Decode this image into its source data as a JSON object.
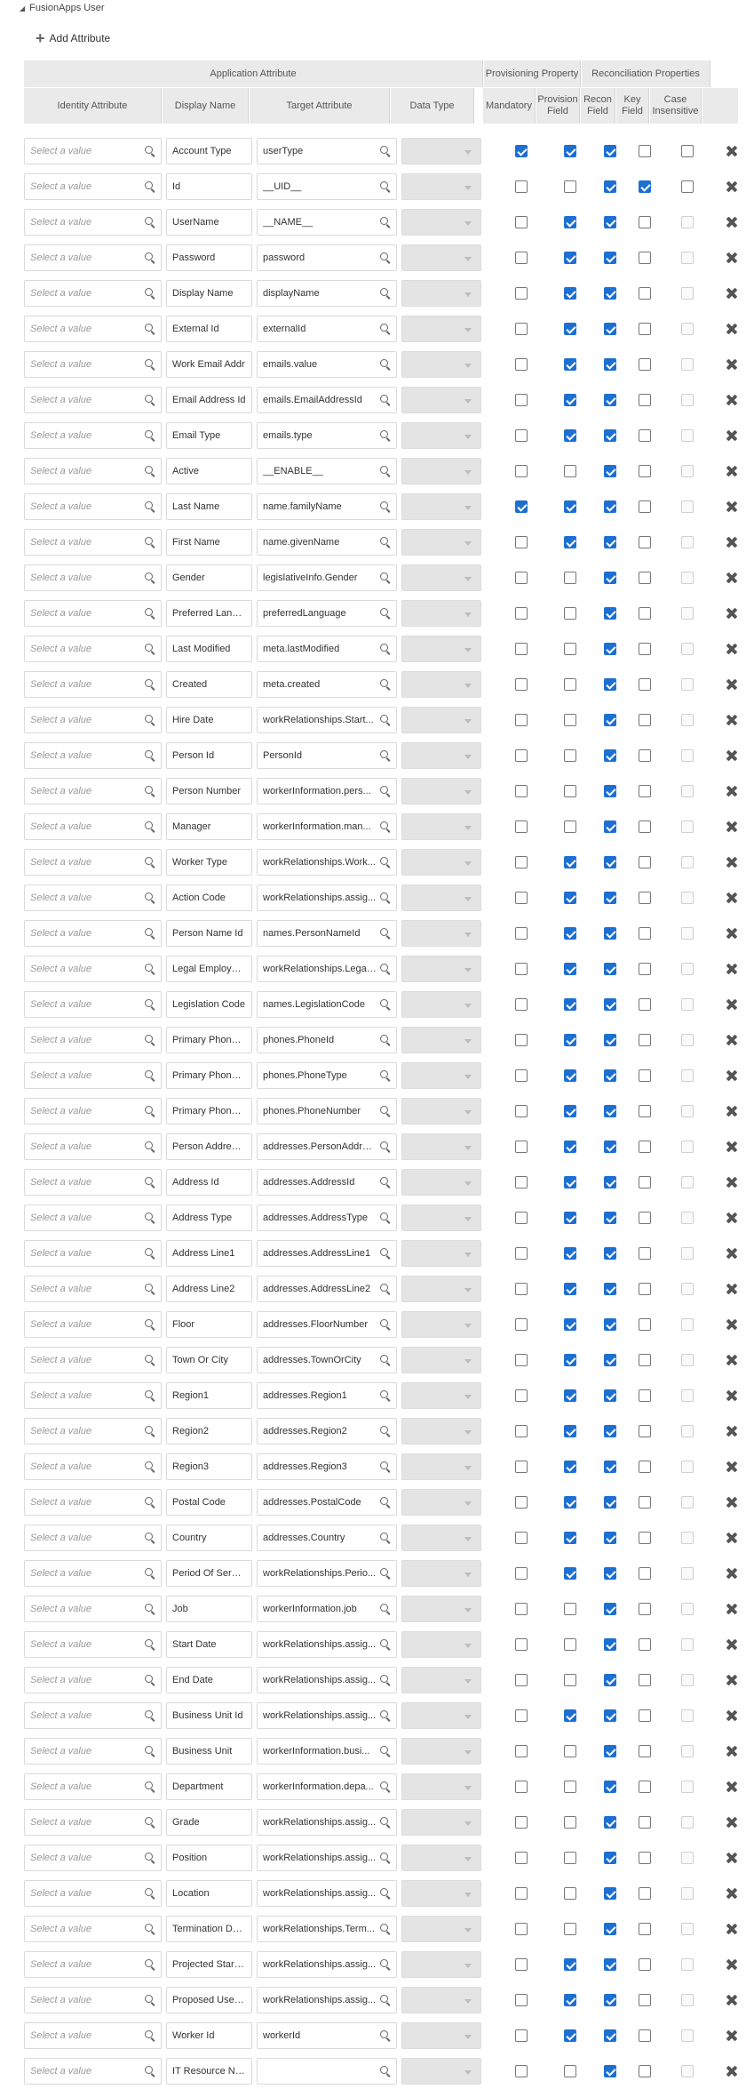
{
  "section": {
    "title": "FusionApps User"
  },
  "toolbar": {
    "add_label": "Add Attribute"
  },
  "headers": {
    "group_application": "Application Attribute",
    "group_provisioning": "Provisioning Property",
    "group_reconciliation": "Reconciliation Properties",
    "identity_attribute": "Identity Attribute",
    "display_name": "Display Name",
    "target_attribute": "Target Attribute",
    "data_type": "Data Type",
    "mandatory": "Mandatory",
    "provision_field": "Provision Field",
    "recon_field": "Recon Field",
    "key_field": "Key Field",
    "case_insensitive": "Case Insensitive"
  },
  "placeholder": "Select a value",
  "rows": [
    {
      "display": "Account Type",
      "target": "userType",
      "mandatory": true,
      "provision": true,
      "recon": true,
      "key": false,
      "case": false,
      "case_enabled": true
    },
    {
      "display": "Id",
      "target": "__UID__",
      "mandatory": false,
      "provision": false,
      "recon": true,
      "key": true,
      "case": false,
      "case_enabled": true
    },
    {
      "display": "UserName",
      "target": "__NAME__",
      "mandatory": false,
      "provision": true,
      "recon": true,
      "key": false,
      "case": false,
      "case_enabled": false
    },
    {
      "display": "Password",
      "target": "password",
      "mandatory": false,
      "provision": true,
      "recon": true,
      "key": false,
      "case": false,
      "case_enabled": false
    },
    {
      "display": "Display Name",
      "target": "displayName",
      "mandatory": false,
      "provision": true,
      "recon": true,
      "key": false,
      "case": false,
      "case_enabled": false
    },
    {
      "display": "External Id",
      "target": "externalId",
      "mandatory": false,
      "provision": true,
      "recon": true,
      "key": false,
      "case": false,
      "case_enabled": false
    },
    {
      "display": "Work Email Addr",
      "target": "emails.value",
      "mandatory": false,
      "provision": true,
      "recon": true,
      "key": false,
      "case": false,
      "case_enabled": false
    },
    {
      "display": "Email Address Id",
      "target": "emails.EmailAddressId",
      "mandatory": false,
      "provision": true,
      "recon": true,
      "key": false,
      "case": false,
      "case_enabled": false
    },
    {
      "display": "Email Type",
      "target": "emails.type",
      "mandatory": false,
      "provision": true,
      "recon": true,
      "key": false,
      "case": false,
      "case_enabled": false
    },
    {
      "display": "Active",
      "target": "__ENABLE__",
      "mandatory": false,
      "provision": false,
      "recon": true,
      "key": false,
      "case": false,
      "case_enabled": false
    },
    {
      "display": "Last Name",
      "target": "name.familyName",
      "mandatory": true,
      "provision": true,
      "recon": true,
      "key": false,
      "case": false,
      "case_enabled": false
    },
    {
      "display": "First Name",
      "target": "name.givenName",
      "mandatory": false,
      "provision": true,
      "recon": true,
      "key": false,
      "case": false,
      "case_enabled": false
    },
    {
      "display": "Gender",
      "target": "legislativeInfo.Gender",
      "mandatory": false,
      "provision": false,
      "recon": true,
      "key": false,
      "case": false,
      "case_enabled": false
    },
    {
      "display": "Preferred Langua",
      "target": "preferredLanguage",
      "mandatory": false,
      "provision": false,
      "recon": true,
      "key": false,
      "case": false,
      "case_enabled": false
    },
    {
      "display": "Last Modified",
      "target": "meta.lastModified",
      "mandatory": false,
      "provision": false,
      "recon": true,
      "key": false,
      "case": false,
      "case_enabled": false
    },
    {
      "display": "Created",
      "target": "meta.created",
      "mandatory": false,
      "provision": false,
      "recon": true,
      "key": false,
      "case": false,
      "case_enabled": false
    },
    {
      "display": "Hire Date",
      "target": "workRelationships.Start...",
      "mandatory": false,
      "provision": false,
      "recon": true,
      "key": false,
      "case": false,
      "case_enabled": false
    },
    {
      "display": "Person Id",
      "target": "PersonId",
      "mandatory": false,
      "provision": false,
      "recon": true,
      "key": false,
      "case": false,
      "case_enabled": false
    },
    {
      "display": "Person Number",
      "target": "workerInformation.pers...",
      "mandatory": false,
      "provision": false,
      "recon": true,
      "key": false,
      "case": false,
      "case_enabled": false
    },
    {
      "display": "Manager",
      "target": "workerInformation.man...",
      "mandatory": false,
      "provision": false,
      "recon": true,
      "key": false,
      "case": false,
      "case_enabled": false
    },
    {
      "display": "Worker Type",
      "target": "workRelationships.Work...",
      "mandatory": false,
      "provision": true,
      "recon": true,
      "key": false,
      "case": false,
      "case_enabled": false
    },
    {
      "display": "Action Code",
      "target": "workRelationships.assig...",
      "mandatory": false,
      "provision": true,
      "recon": true,
      "key": false,
      "case": false,
      "case_enabled": false
    },
    {
      "display": "Person Name Id",
      "target": "names.PersonNameId",
      "mandatory": false,
      "provision": true,
      "recon": true,
      "key": false,
      "case": false,
      "case_enabled": false
    },
    {
      "display": "Legal Employer N",
      "target": "workRelationships.Legal...",
      "mandatory": false,
      "provision": true,
      "recon": true,
      "key": false,
      "case": false,
      "case_enabled": false
    },
    {
      "display": "Legislation Code",
      "target": "names.LegislationCode",
      "mandatory": false,
      "provision": true,
      "recon": true,
      "key": false,
      "case": false,
      "case_enabled": false
    },
    {
      "display": "Primary Phone Id",
      "target": "phones.PhoneId",
      "mandatory": false,
      "provision": true,
      "recon": true,
      "key": false,
      "case": false,
      "case_enabled": false
    },
    {
      "display": "Primary Phone Ty",
      "target": "phones.PhoneType",
      "mandatory": false,
      "provision": true,
      "recon": true,
      "key": false,
      "case": false,
      "case_enabled": false
    },
    {
      "display": "Primary Phone N",
      "target": "phones.PhoneNumber",
      "mandatory": false,
      "provision": true,
      "recon": true,
      "key": false,
      "case": false,
      "case_enabled": false
    },
    {
      "display": "Person Address U",
      "target": "addresses.PersonAddrU...",
      "mandatory": false,
      "provision": true,
      "recon": true,
      "key": false,
      "case": false,
      "case_enabled": false
    },
    {
      "display": "Address Id",
      "target": "addresses.AddressId",
      "mandatory": false,
      "provision": true,
      "recon": true,
      "key": false,
      "case": false,
      "case_enabled": false
    },
    {
      "display": "Address Type",
      "target": "addresses.AddressType",
      "mandatory": false,
      "provision": true,
      "recon": true,
      "key": false,
      "case": false,
      "case_enabled": false
    },
    {
      "display": "Address Line1",
      "target": "addresses.AddressLine1",
      "mandatory": false,
      "provision": true,
      "recon": true,
      "key": false,
      "case": false,
      "case_enabled": false
    },
    {
      "display": "Address Line2",
      "target": "addresses.AddressLine2",
      "mandatory": false,
      "provision": true,
      "recon": true,
      "key": false,
      "case": false,
      "case_enabled": false
    },
    {
      "display": "Floor",
      "target": "addresses.FloorNumber",
      "mandatory": false,
      "provision": true,
      "recon": true,
      "key": false,
      "case": false,
      "case_enabled": false
    },
    {
      "display": "Town Or City",
      "target": "addresses.TownOrCity",
      "mandatory": false,
      "provision": true,
      "recon": true,
      "key": false,
      "case": false,
      "case_enabled": false
    },
    {
      "display": "Region1",
      "target": "addresses.Region1",
      "mandatory": false,
      "provision": true,
      "recon": true,
      "key": false,
      "case": false,
      "case_enabled": false
    },
    {
      "display": "Region2",
      "target": "addresses.Region2",
      "mandatory": false,
      "provision": true,
      "recon": true,
      "key": false,
      "case": false,
      "case_enabled": false
    },
    {
      "display": "Region3",
      "target": "addresses.Region3",
      "mandatory": false,
      "provision": true,
      "recon": true,
      "key": false,
      "case": false,
      "case_enabled": false
    },
    {
      "display": "Postal Code",
      "target": "addresses.PostalCode",
      "mandatory": false,
      "provision": true,
      "recon": true,
      "key": false,
      "case": false,
      "case_enabled": false
    },
    {
      "display": "Country",
      "target": "addresses.Country",
      "mandatory": false,
      "provision": true,
      "recon": true,
      "key": false,
      "case": false,
      "case_enabled": false
    },
    {
      "display": "Period Of Service",
      "target": "workRelationships.Perio...",
      "mandatory": false,
      "provision": true,
      "recon": true,
      "key": false,
      "case": false,
      "case_enabled": false
    },
    {
      "display": "Job",
      "target": "workerInformation.job",
      "mandatory": false,
      "provision": false,
      "recon": true,
      "key": false,
      "case": false,
      "case_enabled": false
    },
    {
      "display": "Start Date",
      "target": "workRelationships.assig...",
      "mandatory": false,
      "provision": false,
      "recon": true,
      "key": false,
      "case": false,
      "case_enabled": false
    },
    {
      "display": "End Date",
      "target": "workRelationships.assig...",
      "mandatory": false,
      "provision": false,
      "recon": true,
      "key": false,
      "case": false,
      "case_enabled": false
    },
    {
      "display": "Business Unit Id",
      "target": "workRelationships.assig...",
      "mandatory": false,
      "provision": true,
      "recon": true,
      "key": false,
      "case": false,
      "case_enabled": false
    },
    {
      "display": "Business Unit",
      "target": "workerInformation.busi...",
      "mandatory": false,
      "provision": false,
      "recon": true,
      "key": false,
      "case": false,
      "case_enabled": false
    },
    {
      "display": "Department",
      "target": "workerInformation.depa...",
      "mandatory": false,
      "provision": false,
      "recon": true,
      "key": false,
      "case": false,
      "case_enabled": false
    },
    {
      "display": "Grade",
      "target": "workRelationships.assig...",
      "mandatory": false,
      "provision": false,
      "recon": true,
      "key": false,
      "case": false,
      "case_enabled": false
    },
    {
      "display": "Position",
      "target": "workRelationships.assig...",
      "mandatory": false,
      "provision": false,
      "recon": true,
      "key": false,
      "case": false,
      "case_enabled": false
    },
    {
      "display": "Location",
      "target": "workRelationships.assig...",
      "mandatory": false,
      "provision": false,
      "recon": true,
      "key": false,
      "case": false,
      "case_enabled": false
    },
    {
      "display": "Termination Date",
      "target": "workRelationships.Term...",
      "mandatory": false,
      "provision": false,
      "recon": true,
      "key": false,
      "case": false,
      "case_enabled": false
    },
    {
      "display": "Projected Start D",
      "target": "workRelationships.assig...",
      "mandatory": false,
      "provision": true,
      "recon": true,
      "key": false,
      "case": false,
      "case_enabled": false
    },
    {
      "display": "Proposed User Pe",
      "target": "workRelationships.assig...",
      "mandatory": false,
      "provision": true,
      "recon": true,
      "key": false,
      "case": false,
      "case_enabled": false
    },
    {
      "display": "Worker Id",
      "target": "workerId",
      "mandatory": false,
      "provision": true,
      "recon": true,
      "key": false,
      "case": false,
      "case_enabled": false
    },
    {
      "display": "IT Resource Nam",
      "target": "",
      "mandatory": false,
      "provision": false,
      "recon": true,
      "key": false,
      "case": false,
      "case_enabled": false
    }
  ]
}
